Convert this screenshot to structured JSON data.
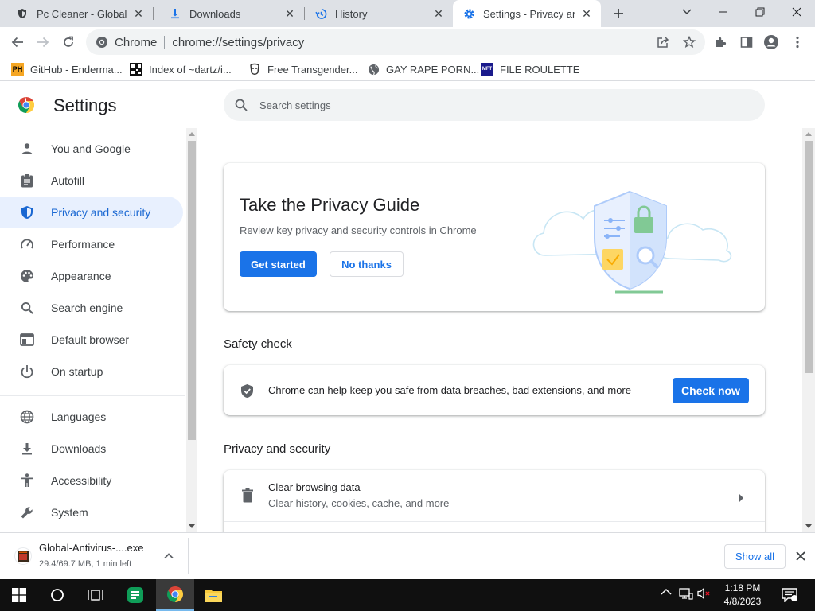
{
  "tabs": [
    {
      "title": "Pc Cleaner - Global Mc",
      "icon": "shield-favicon",
      "active": false
    },
    {
      "title": "Downloads",
      "icon": "download-favicon",
      "active": false
    },
    {
      "title": "History",
      "icon": "history-favicon",
      "active": false
    },
    {
      "title": "Settings - Privacy and",
      "icon": "settings-favicon",
      "active": true
    }
  ],
  "toolbar": {
    "site_label": "Chrome",
    "url": "chrome://settings/privacy"
  },
  "bookmarks": [
    {
      "label": "GitHub - Enderma...",
      "icon_text": "PH"
    },
    {
      "label": "Index of ~dartz/i...",
      "icon_text": ""
    },
    {
      "label": "Free Transgender...",
      "icon_text": ""
    },
    {
      "label": "GAY RAPE PORN...",
      "icon_text": ""
    },
    {
      "label": "FILE ROULETTE",
      "icon_text": "MFT"
    }
  ],
  "settings": {
    "title": "Settings",
    "search_placeholder": "Search settings",
    "sidebar": [
      {
        "label": "You and Google",
        "icon": "person-icon"
      },
      {
        "label": "Autofill",
        "icon": "clipboard-icon"
      },
      {
        "label": "Privacy and security",
        "icon": "shield-icon",
        "active": true
      },
      {
        "label": "Performance",
        "icon": "speedometer-icon"
      },
      {
        "label": "Appearance",
        "icon": "palette-icon"
      },
      {
        "label": "Search engine",
        "icon": "search-icon"
      },
      {
        "label": "Default browser",
        "icon": "browser-icon"
      },
      {
        "label": "On startup",
        "icon": "power-icon"
      },
      {
        "label": "Languages",
        "icon": "globe-icon"
      },
      {
        "label": "Downloads",
        "icon": "download-icon"
      },
      {
        "label": "Accessibility",
        "icon": "accessibility-icon"
      },
      {
        "label": "System",
        "icon": "wrench-icon"
      }
    ],
    "privacy_guide": {
      "title": "Take the Privacy Guide",
      "subtitle": "Review key privacy and security controls in Chrome",
      "primary_button": "Get started",
      "secondary_button": "No thanks"
    },
    "safety_check": {
      "heading": "Safety check",
      "text": "Chrome can help keep you safe from data breaches, bad extensions, and more",
      "button": "Check now"
    },
    "privacy_section": {
      "heading": "Privacy and security",
      "rows": [
        {
          "title": "Clear browsing data",
          "subtitle": "Clear history, cookies, cache, and more"
        }
      ]
    }
  },
  "download": {
    "filename": "Global-Antivirus-....exe",
    "status": "29.4/69.7 MB, 1 min left",
    "show_all": "Show all"
  },
  "taskbar": {
    "time": "1:18 PM",
    "date": "4/8/2023"
  },
  "colors": {
    "accent": "#1a73e8",
    "active_nav_bg": "#e8f0fe",
    "tab_strip": "#dee1e6",
    "taskbar": "#101010"
  }
}
